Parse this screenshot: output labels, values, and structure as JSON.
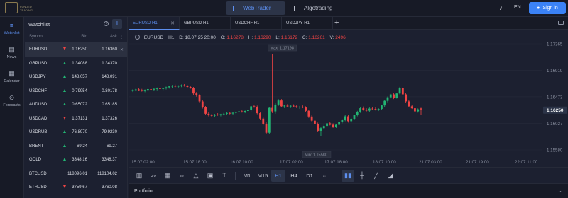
{
  "header": {
    "logo_text": "FUNDED TRADING",
    "tabs": [
      {
        "label": "WebTrader",
        "active": true
      },
      {
        "label": "Algotrading",
        "active": false
      }
    ],
    "language": "EN",
    "signin_label": "Sign in",
    "accent": "#3b82f6"
  },
  "nav": {
    "items": [
      {
        "label": "Watchlist",
        "icon": "watchlist-icon",
        "active": true
      },
      {
        "label": "News",
        "icon": "news-icon"
      },
      {
        "label": "Calendar",
        "icon": "calendar-icon"
      },
      {
        "label": "Forecasts",
        "icon": "forecasts-icon"
      }
    ]
  },
  "watchlist": {
    "title": "Watchlist",
    "columns": {
      "symbol": "Symbol",
      "bid": "Bid",
      "ask": "Ask"
    },
    "rows": [
      {
        "symbol": "EURUSD",
        "dir": "down",
        "bid": "1.16250",
        "ask": "1.16360",
        "selected": true
      },
      {
        "symbol": "GBPUSD",
        "dir": "up",
        "bid": "1.34088",
        "ask": "1.34370"
      },
      {
        "symbol": "USDJPY",
        "dir": "up",
        "bid": "148.057",
        "ask": "148.091"
      },
      {
        "symbol": "USDCHF",
        "dir": "up",
        "bid": "0.79954",
        "ask": "0.80178"
      },
      {
        "symbol": "AUDUSD",
        "dir": "up",
        "bid": "0.65072",
        "ask": "0.65185"
      },
      {
        "symbol": "USDCAD",
        "dir": "down",
        "bid": "1.37131",
        "ask": "1.37326"
      },
      {
        "symbol": "USDRUB",
        "dir": "up",
        "bid": "76.8970",
        "ask": "79.9230"
      },
      {
        "symbol": "BRENT",
        "dir": "up",
        "bid": "69.24",
        "ask": "69.27"
      },
      {
        "symbol": "GOLD",
        "dir": "up",
        "bid": "3348.16",
        "ask": "3348.37"
      },
      {
        "symbol": "BTCUSD",
        "dir": "",
        "bid": "118096.01",
        "ask": "118104.02"
      },
      {
        "symbol": "ETHUSD",
        "dir": "down",
        "bid": "3759.67",
        "ask": "3760.08"
      }
    ]
  },
  "chart_tabs": [
    {
      "label": "EURUSD H1",
      "active": true,
      "closable": true
    },
    {
      "label": "GBPUSD H1"
    },
    {
      "label": "USDCHF H1"
    },
    {
      "label": "USDJPY H1"
    }
  ],
  "ohlc": {
    "symbol": "EURUSD",
    "tf": "H1",
    "d_label": "D:",
    "d": "18.07.25 20:00",
    "o_label": "O:",
    "o": "1.16278",
    "h_label": "H:",
    "h": "1.16290",
    "l_label": "L:",
    "l": "1.16172",
    "c_label": "C:",
    "c": "1.16261",
    "v_label": "V:",
    "v": "2496"
  },
  "chart_data": {
    "type": "candlestick",
    "colors": {
      "up": "#22b573",
      "down": "#ef4444",
      "last_bg": "#2c3448"
    },
    "y_ticks": [
      "1.17365",
      "1.16919",
      "1.16473",
      "1.16027",
      "1.15580"
    ],
    "y_range": [
      1.1558,
      1.17365
    ],
    "last_price": "1.16250",
    "max_label": "Max: 1.17198",
    "min_label": "Min: 1.15580",
    "x_ticks": [
      "15.07 02:00",
      "15.07 18:00",
      "16.07 10:00",
      "17.07 02:00",
      "17.07 18:00",
      "18.07 10:00",
      "21.07 03:00",
      "21.07 19:00",
      "22.07 11:00"
    ],
    "candles": [
      [
        1.16575,
        1.16601,
        1.16554,
        1.16587
      ],
      [
        1.16587,
        1.16616,
        1.16566,
        1.16598
      ],
      [
        1.16598,
        1.16624,
        1.16572,
        1.16586
      ],
      [
        1.16586,
        1.16607,
        1.1656,
        1.16572
      ],
      [
        1.16572,
        1.16598,
        1.16551,
        1.16589
      ],
      [
        1.16589,
        1.16618,
        1.16568,
        1.16603
      ],
      [
        1.16603,
        1.16627,
        1.1658,
        1.16594
      ],
      [
        1.16594,
        1.16616,
        1.16572,
        1.16606
      ],
      [
        1.16606,
        1.1663,
        1.16583,
        1.16615
      ],
      [
        1.16615,
        1.16639,
        1.16592,
        1.16606
      ],
      [
        1.16606,
        1.16627,
        1.16586,
        1.16621
      ],
      [
        1.16621,
        1.16645,
        1.16598,
        1.16633
      ],
      [
        1.16633,
        1.1666,
        1.16612,
        1.16648
      ],
      [
        1.16648,
        1.16672,
        1.16624,
        1.16657
      ],
      [
        1.16657,
        1.16678,
        1.16633,
        1.16645
      ],
      [
        1.16645,
        1.16669,
        1.16624,
        1.16657
      ],
      [
        1.16657,
        1.16681,
        1.16636,
        1.16666
      ],
      [
        1.16666,
        1.16687,
        1.16645,
        1.16654
      ],
      [
        1.16654,
        1.16672,
        1.1663,
        1.16639
      ],
      [
        1.16639,
        1.1666,
        1.16609,
        1.16618
      ],
      [
        1.16618,
        1.16639,
        1.16504,
        1.1653
      ],
      [
        1.1653,
        1.16554,
        1.16476,
        1.16497
      ],
      [
        1.16497,
        1.16518,
        1.16377,
        1.16395
      ],
      [
        1.16395,
        1.16416,
        1.16276,
        1.16297
      ],
      [
        1.16297,
        1.16318,
        1.16168,
        1.16189
      ],
      [
        1.16189,
        1.1621,
        1.16145,
        1.16163
      ],
      [
        1.16163,
        1.16186,
        1.16133,
        1.16157
      ],
      [
        1.16157,
        1.16186,
        1.16139,
        1.16175
      ],
      [
        1.16175,
        1.16198,
        1.16154,
        1.16166
      ],
      [
        1.16166,
        1.16189,
        1.16145,
        1.1618
      ],
      [
        1.1618,
        1.16204,
        1.1616,
        1.16189
      ],
      [
        1.16189,
        1.16213,
        1.16169,
        1.16201
      ],
      [
        1.16201,
        1.16222,
        1.16178,
        1.16192
      ],
      [
        1.16192,
        1.16213,
        1.16172,
        1.16204
      ],
      [
        1.16204,
        1.16228,
        1.16183,
        1.16216
      ],
      [
        1.16216,
        1.1624,
        1.16195,
        1.16228
      ],
      [
        1.16228,
        1.16251,
        1.16207,
        1.16219
      ],
      [
        1.16219,
        1.16243,
        1.16198,
        1.16234
      ],
      [
        1.16234,
        1.16257,
        1.16213,
        1.16246
      ],
      [
        1.16246,
        1.16325,
        1.16219,
        1.16313
      ],
      [
        1.16313,
        1.16337,
        1.1629,
        1.16304
      ],
      [
        1.16304,
        1.16325,
        1.1618,
        1.16198
      ],
      [
        1.16198,
        1.16219,
        1.16086,
        1.16107
      ],
      [
        1.16107,
        1.1613,
        1.15994,
        1.16018
      ],
      [
        1.16018,
        1.16042,
        1.15845,
        1.15869
      ],
      [
        1.15869,
        1.16302,
        1.15845,
        1.16287
      ],
      [
        1.16287,
        1.17198,
        1.16201,
        1.16228
      ],
      [
        1.16228,
        1.16373,
        1.16189,
        1.16343
      ],
      [
        1.16343,
        1.16435,
        1.1632,
        1.16411
      ],
      [
        1.16411,
        1.16435,
        1.16296,
        1.16313
      ],
      [
        1.16313,
        1.1634,
        1.16284,
        1.16325
      ],
      [
        1.16325,
        1.16352,
        1.16299,
        1.1631
      ],
      [
        1.1631,
        1.16334,
        1.16284,
        1.16322
      ],
      [
        1.16322,
        1.16346,
        1.16299,
        1.16313
      ],
      [
        1.16313,
        1.16334,
        1.16284,
        1.16296
      ],
      [
        1.16296,
        1.16319,
        1.16272,
        1.16305
      ],
      [
        1.16305,
        1.16328,
        1.16281,
        1.16293
      ],
      [
        1.16293,
        1.16313,
        1.16216,
        1.16237
      ],
      [
        1.16237,
        1.16258,
        1.16118,
        1.16142
      ],
      [
        1.16142,
        1.16163,
        1.16051,
        1.16072
      ],
      [
        1.16072,
        1.16095,
        1.15997,
        1.16018
      ],
      [
        1.16018,
        1.16039,
        1.15878,
        1.15902
      ],
      [
        1.15902,
        1.15961,
        1.15818,
        1.15946
      ],
      [
        1.15946,
        1.16004,
        1.15925,
        1.15983
      ],
      [
        1.15983,
        1.16042,
        1.15967,
        1.16027
      ],
      [
        1.16027,
        1.16051,
        1.15991,
        1.16003
      ],
      [
        1.16003,
        1.16027,
        1.15949,
        1.1597
      ],
      [
        1.1597,
        1.16015,
        1.15949,
        1.16003
      ],
      [
        1.16003,
        1.16063,
        1.15985,
        1.16051
      ],
      [
        1.16051,
        1.16098,
        1.16027,
        1.16086
      ],
      [
        1.16086,
        1.16163,
        1.16063,
        1.16145
      ],
      [
        1.16145,
        1.16169,
        1.16039,
        1.16063
      ],
      [
        1.16063,
        1.16118,
        1.16039,
        1.16104
      ],
      [
        1.16104,
        1.16175,
        1.16086,
        1.16163
      ],
      [
        1.16163,
        1.16237,
        1.16145,
        1.16222
      ],
      [
        1.16222,
        1.16299,
        1.16204,
        1.16281
      ],
      [
        1.16281,
        1.1631,
        1.1624,
        1.16257
      ],
      [
        1.16257,
        1.16281,
        1.16225,
        1.1624
      ],
      [
        1.1624,
        1.16293,
        1.16222,
        1.16275
      ],
      [
        1.16275,
        1.16302,
        1.16251,
        1.16269
      ],
      [
        1.16269,
        1.16293,
        1.16243,
        1.16257
      ],
      [
        1.16257,
        1.16281,
        1.16234,
        1.16269
      ],
      [
        1.16269,
        1.1634,
        1.16251,
        1.16328
      ],
      [
        1.16328,
        1.1642,
        1.16305,
        1.16405
      ],
      [
        1.16405,
        1.16479,
        1.16381,
        1.16464
      ],
      [
        1.16464,
        1.16529,
        1.16443,
        1.16514
      ],
      [
        1.16514,
        1.16538,
        1.16435,
        1.16456
      ],
      [
        1.16456,
        1.16538,
        1.16443,
        1.16529
      ],
      [
        1.16529,
        1.1664,
        1.16514,
        1.16625
      ],
      [
        1.16625,
        1.1664,
        1.16497,
        1.16514
      ],
      [
        1.16514,
        1.16538,
        1.16373,
        1.16396
      ],
      [
        1.16396,
        1.16414,
        1.16296,
        1.16313
      ],
      [
        1.16313,
        1.16337,
        1.16269,
        1.16281
      ],
      [
        1.16281,
        1.16296,
        1.16216,
        1.16228
      ],
      [
        1.16228,
        1.16278,
        1.16207,
        1.16263
      ],
      [
        1.16278,
        1.1629,
        1.16172,
        1.16261
      ]
    ]
  },
  "toolbar": {
    "timeframes": [
      "M1",
      "M15",
      "H1",
      "H4",
      "D1"
    ],
    "active_tf": "H1",
    "more": "···"
  },
  "portfolio": {
    "label": "Portfolio"
  }
}
